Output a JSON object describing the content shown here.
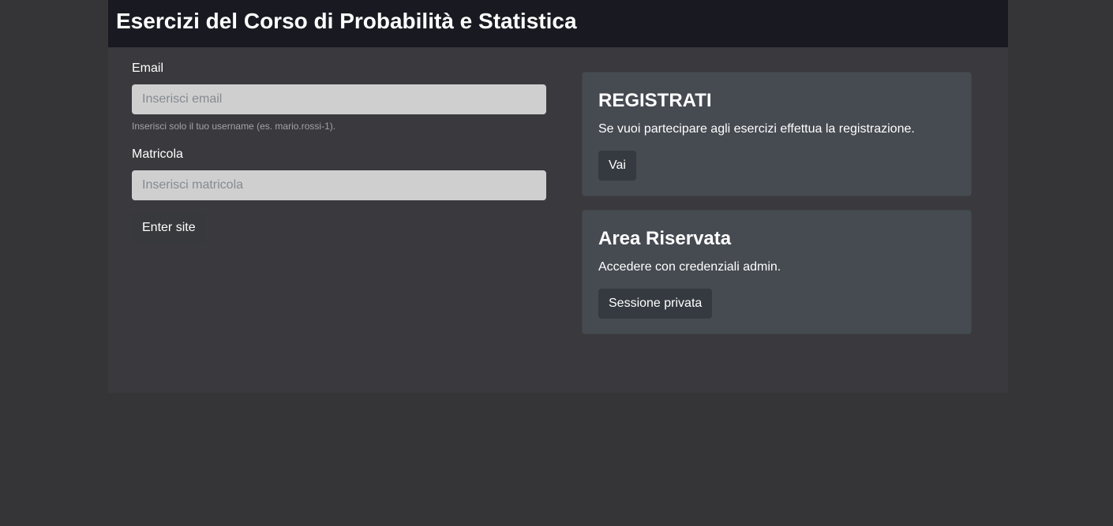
{
  "header": {
    "title": "Esercizi del Corso di Probabilità e Statistica"
  },
  "login_form": {
    "email_label": "Email",
    "email_value": "",
    "email_placeholder": "Inserisci email",
    "email_help": "Inserisci solo il tuo username (es. mario.rossi-1).",
    "matricola_label": "Matricola",
    "matricola_value": "",
    "matricola_placeholder": "Inserisci matricola",
    "submit_label": "Enter site"
  },
  "cards": [
    {
      "title": "REGISTRATI",
      "text": "Se vuoi partecipare agli esercizi effettua la registrazione.",
      "button_label": "Vai"
    },
    {
      "title": "Area Riservata",
      "text": "Accedere con credenziali admin.",
      "button_label": "Sessione privata"
    }
  ],
  "colors": {
    "page_background": "#353537",
    "container_background": "#3a393d",
    "header_background": "#191921",
    "card_background": "#464a51",
    "input_background": "#cfcfcf",
    "button_background": "#343a40"
  }
}
